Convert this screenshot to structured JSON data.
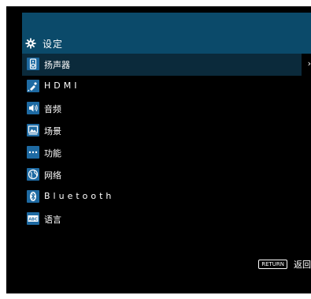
{
  "header": {
    "title": "设定",
    "icon": "gear-icon"
  },
  "menu": {
    "items": [
      {
        "label": "扬声器",
        "icon": "speaker-icon",
        "selected": true
      },
      {
        "label": "HDMI",
        "icon": "hdmi-plug-icon"
      },
      {
        "label": "音频",
        "icon": "audio-icon"
      },
      {
        "label": "场景",
        "icon": "scene-icon"
      },
      {
        "label": "功能",
        "icon": "more-dots-icon"
      },
      {
        "label": "网络",
        "icon": "globe-icon"
      },
      {
        "label": "Bluetooth",
        "icon": "bluetooth-icon"
      },
      {
        "label": "语言",
        "icon": "abc-icon"
      }
    ],
    "chevron": "›"
  },
  "footer": {
    "return_key": "RETURN",
    "return_label": "返回"
  },
  "colors": {
    "background": "#000000",
    "header": "#0b4a6a",
    "selected_row": "#0b2a3b",
    "icon_tile": "#1e6aa2",
    "text": "#ffffff"
  }
}
